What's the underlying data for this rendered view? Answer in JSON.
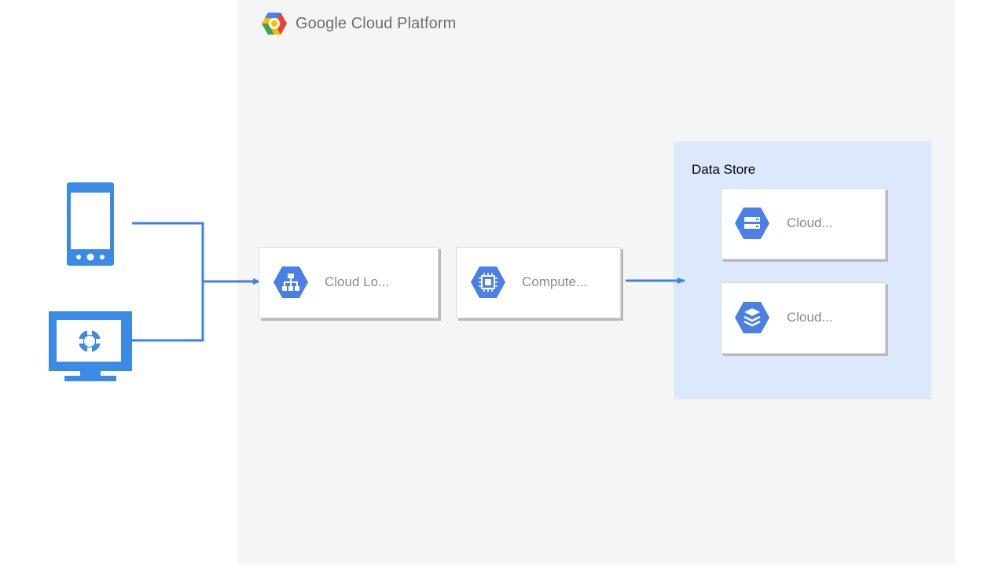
{
  "platform": {
    "title": "Google Cloud Platform",
    "icon": "google-cloud-logo-icon"
  },
  "clients": {
    "mobile_icon": "mobile-phone-icon",
    "desktop_icon": "desktop-monitor-icon"
  },
  "services": [
    {
      "label": "Cloud Lo...",
      "icon": "load-balancing-icon"
    },
    {
      "label": "Compute...",
      "icon": "compute-engine-icon"
    }
  ],
  "data_store": {
    "title": "Data Store",
    "items": [
      {
        "label": "Cloud...",
        "icon": "cloud-storage-icon"
      },
      {
        "label": "Cloud...",
        "icon": "cloud-datastore-icon"
      }
    ]
  },
  "colors": {
    "accent": "#4285f4",
    "connector": "#3b82e6",
    "panel": "#f5f5f5",
    "zone": "#dce8fc",
    "label": "#8a8a8a"
  }
}
